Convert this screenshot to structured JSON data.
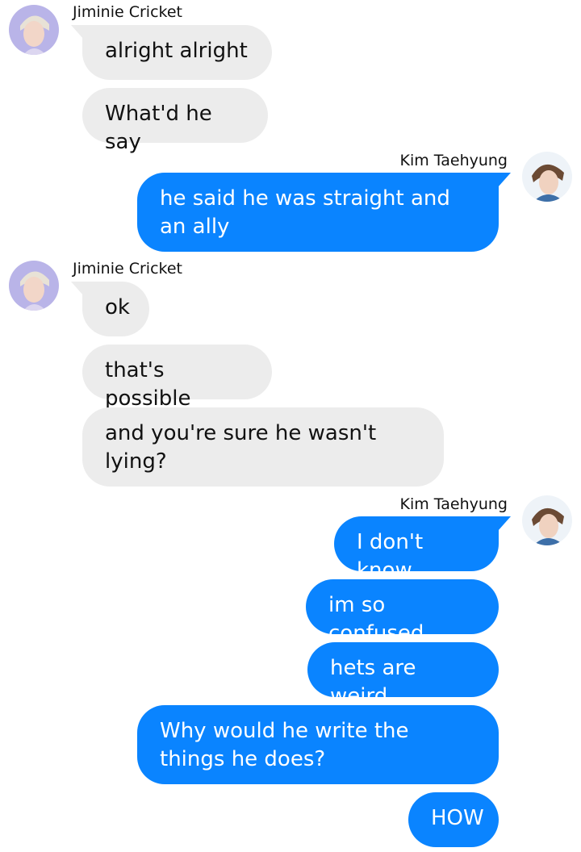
{
  "avatar_icons": {
    "jimin": "avatar-jiminie-cricket",
    "taehyung": "avatar-kim-taehyung"
  },
  "colors": {
    "incoming_bubble": "#ececec",
    "outgoing_bubble": "#0a84ff"
  },
  "groups": [
    {
      "sender": "Jiminie Cricket",
      "messages": [
        "alright alright",
        "What'd he say"
      ]
    },
    {
      "sender": "Kim Taehyung",
      "messages": [
        "he said he was straight and an ally"
      ]
    },
    {
      "sender": "Jiminie Cricket",
      "messages": [
        "ok",
        "that's possible",
        "and you're sure he wasn't lying?"
      ]
    },
    {
      "sender": "Kim Taehyung",
      "messages": [
        "I don't know",
        "im so confused",
        "hets are weird",
        "Why would he write the things he does?",
        "HOW"
      ]
    }
  ]
}
